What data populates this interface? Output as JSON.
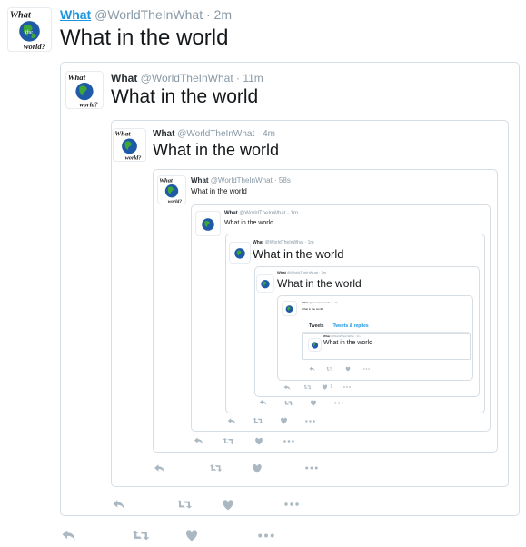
{
  "logo": {
    "text_top": "What",
    "text_mid": "in",
    "text_mid2": "the",
    "text_bottom": "world?"
  },
  "colors": {
    "name": "#292f33",
    "link": "#1b95e0",
    "meta": "#8899a6",
    "icon": "#aab8c2",
    "border": "#d6dde3"
  },
  "tweet1": {
    "name": "What",
    "handle": "@WorldTheInWhat",
    "time": "· 2m",
    "text": "What in the world"
  },
  "tweet2": {
    "name": "What",
    "handle": "@WorldTheInWhat",
    "time": "· 11m",
    "text": "What in the world"
  },
  "tweet3": {
    "name": "What",
    "handle": "@WorldTheInWhat",
    "time": "· 4m",
    "text": "What in the world"
  },
  "tweet4": {
    "name": "What",
    "handle": "@WorldTheInWhat",
    "time": "· 58s",
    "text": "What in the world"
  },
  "tweet5": {
    "name": "What",
    "handle": "@WorldTheInWhat",
    "time": "· 1m",
    "text": "What in the world"
  },
  "tweet6": {
    "name": "What",
    "handle": "@WorldTheInWhat",
    "time": "· 1m",
    "text": "What in the world"
  },
  "tweet7": {
    "name": "What",
    "handle": "@WorldTheInWhat",
    "time": "· 3m",
    "text": "What in the world"
  },
  "tweet8": {
    "name": "What",
    "handle": "@WorldTheInWhat",
    "time": "· 2h",
    "text": "What in the world"
  },
  "tweet9": {
    "name": "What",
    "handle": "@WorldTheInWhat",
    "time": "· 3m",
    "text": "What in the world"
  },
  "profile_tabs": {
    "tweets": "Tweets",
    "replies": "Tweets & replies"
  },
  "actions": {
    "reply": "reply-icon",
    "retweet": "retweet-icon",
    "like": "heart-icon",
    "more": "more-icon",
    "like_count": "1"
  }
}
